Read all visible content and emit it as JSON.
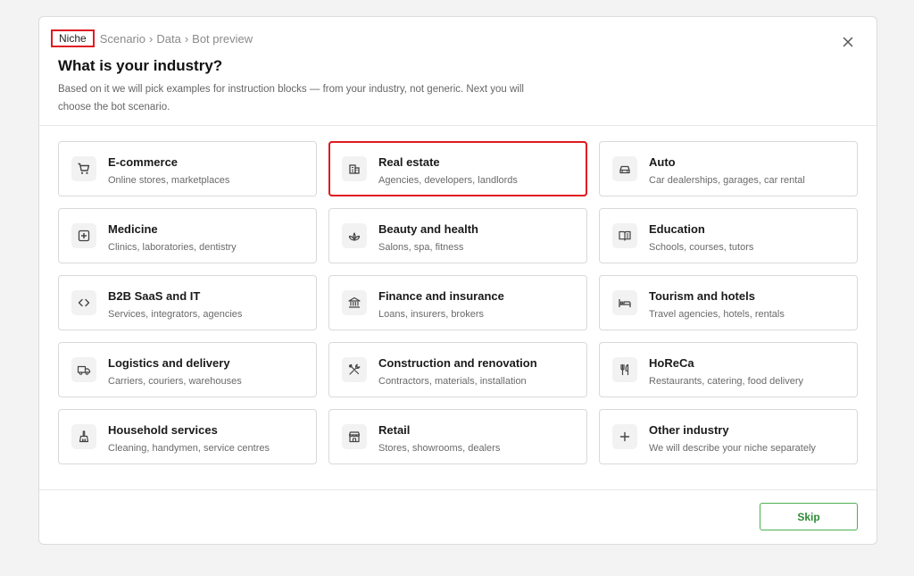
{
  "breadcrumb": {
    "active": "Niche",
    "items": [
      "Scenario",
      "Data",
      "Bot preview"
    ],
    "separator": "›"
  },
  "header": {
    "title": "What is your industry?",
    "subtitle": "Based on it we will pick examples for instruction blocks — from your industry, not generic. Next you will choose the bot scenario."
  },
  "industries": [
    {
      "title": "E-commerce",
      "desc": "Online stores, marketplaces",
      "icon": "cart-icon"
    },
    {
      "title": "Real estate",
      "desc": "Agencies, developers, landlords",
      "icon": "building-icon",
      "selected": true
    },
    {
      "title": "Auto",
      "desc": "Car dealerships, garages, car rental",
      "icon": "car-icon"
    },
    {
      "title": "Medicine",
      "desc": "Clinics, laboratories, dentistry",
      "icon": "medical-icon"
    },
    {
      "title": "Beauty and health",
      "desc": "Salons, spa, fitness",
      "icon": "spa-icon"
    },
    {
      "title": "Education",
      "desc": "Schools, courses, tutors",
      "icon": "book-icon"
    },
    {
      "title": "B2B SaaS and IT",
      "desc": "Services, integrators, agencies",
      "icon": "code-icon"
    },
    {
      "title": "Finance and insurance",
      "desc": "Loans, insurers, brokers",
      "icon": "bank-icon"
    },
    {
      "title": "Tourism and hotels",
      "desc": "Travel agencies, hotels, rentals",
      "icon": "bed-icon"
    },
    {
      "title": "Logistics and delivery",
      "desc": "Carriers, couriers, warehouses",
      "icon": "truck-icon"
    },
    {
      "title": "Construction and renovation",
      "desc": "Contractors, materials, installation",
      "icon": "tools-icon"
    },
    {
      "title": "HoReCa",
      "desc": "Restaurants, catering, food delivery",
      "icon": "cutlery-icon"
    },
    {
      "title": "Household services",
      "desc": "Cleaning, handymen, service centres",
      "icon": "broom-icon"
    },
    {
      "title": "Retail",
      "desc": "Stores, showrooms, dealers",
      "icon": "store-icon"
    },
    {
      "title": "Other industry",
      "desc": "We will describe your niche separately",
      "icon": "plus-icon"
    }
  ],
  "footer": {
    "skip_label": "Skip"
  },
  "colors": {
    "accent_green": "#2e8b35",
    "highlight_red": "#e01b22"
  }
}
